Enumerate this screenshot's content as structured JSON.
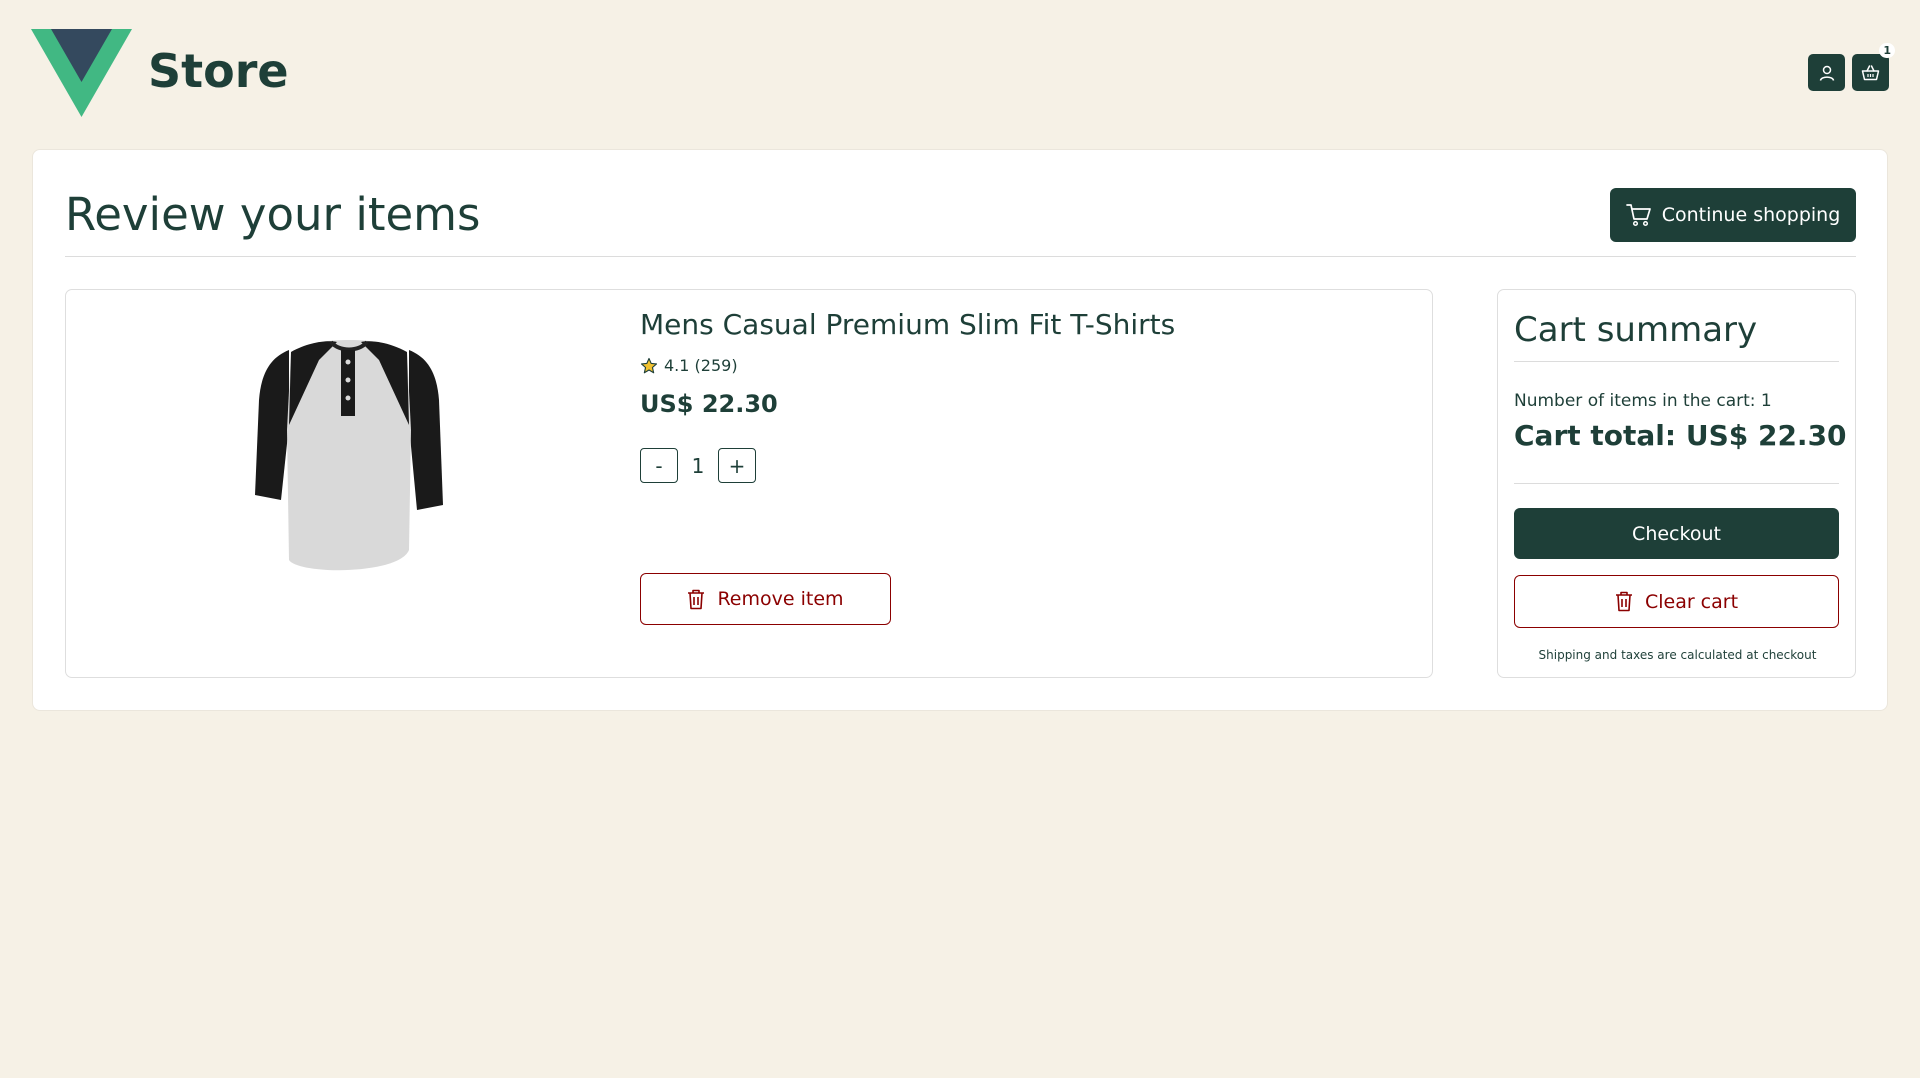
{
  "header": {
    "store_name": "Store",
    "cart_count": "1",
    "icons": {
      "user": "user-icon",
      "cart": "shopping-basket-icon"
    }
  },
  "page": {
    "title": "Review your items",
    "continue_label": "Continue shopping"
  },
  "item": {
    "name": "Mens Casual Premium Slim Fit T-Shirts",
    "rating": "4.1 (259)",
    "price": "US$ 22.30",
    "quantity": "1",
    "decrease_label": "-",
    "increase_label": "+",
    "remove_label": "Remove item"
  },
  "summary": {
    "title": "Cart summary",
    "items_count_text": "Number of items in the cart: 1",
    "total_text": "Cart total: US$ 22.30",
    "checkout_label": "Checkout",
    "clear_label": "Clear cart",
    "shipping_note": "Shipping and taxes are calculated at checkout"
  },
  "colors": {
    "background": "#f6f1e6",
    "primary": "#1e3f38",
    "danger": "#8b0000",
    "logo_green": "#41b883",
    "logo_dark": "#34495e",
    "star": "#f2c230"
  }
}
